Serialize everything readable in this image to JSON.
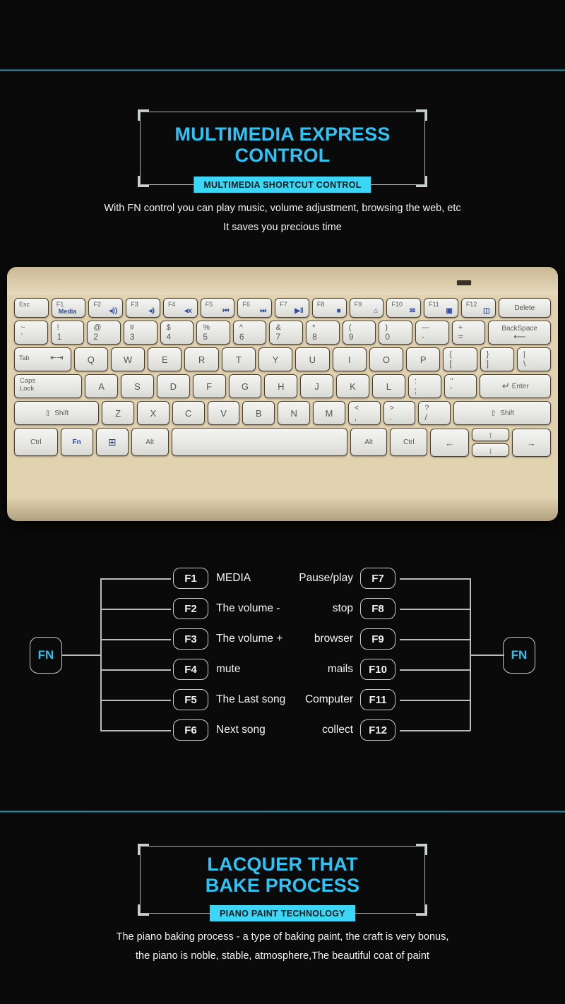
{
  "sections": {
    "multimedia": {
      "title": "MULTIMEDIA EXPRESS CONTROL",
      "badge": "MULTIMEDIA SHORTCUT CONTROL",
      "desc_line1": "With FN control you can play music, volume adjustment, browsing the web, etc",
      "desc_line2": "It saves you precious time"
    },
    "lacquer": {
      "title": "LACQUER THAT\nBAKE PROCESS",
      "badge": "PIANO PAINT TECHNOLOGY",
      "desc_line1": "The piano baking process - a type of baking paint, the craft is very bonus,",
      "desc_line2": "the piano is noble, stable, atmosphere,The beautiful coat of paint"
    }
  },
  "colors": {
    "accent_cyan": "#2ec2f5",
    "badge_bg": "#3ad7f7",
    "divider": "#3c93ab",
    "keyboard_gold": "#e1d2b0",
    "key_face": "#eeeeec",
    "fn_blue": "#2e4d9e"
  },
  "keyboard": {
    "row_fn": [
      {
        "label": "Esc"
      },
      {
        "label": "F1",
        "sub": "Media"
      },
      {
        "label": "F2",
        "icon": "volume-low-icon",
        "glyph": "◂))"
      },
      {
        "label": "F3",
        "icon": "volume-high-icon",
        "glyph": "◂)"
      },
      {
        "label": "F4",
        "icon": "mute-icon",
        "glyph": "◂x"
      },
      {
        "label": "F5",
        "icon": "previous-track-icon",
        "glyph": "⏮"
      },
      {
        "label": "F6",
        "icon": "next-track-icon",
        "glyph": "⏭"
      },
      {
        "label": "F7",
        "icon": "play-pause-icon",
        "glyph": "▶‖"
      },
      {
        "label": "F8",
        "icon": "stop-icon",
        "glyph": "■"
      },
      {
        "label": "F9",
        "icon": "browser-home-icon",
        "glyph": "⌂"
      },
      {
        "label": "F10",
        "icon": "mail-icon",
        "glyph": "✉"
      },
      {
        "label": "F11",
        "icon": "computer-icon",
        "glyph": "▣"
      },
      {
        "label": "F12",
        "icon": "collect-icon",
        "glyph": "◫"
      },
      {
        "label": "Delete"
      }
    ],
    "row_num": [
      {
        "top": "~",
        "bot": "`"
      },
      {
        "top": "!",
        "bot": "1"
      },
      {
        "top": "@",
        "bot": "2"
      },
      {
        "top": "#",
        "bot": "3"
      },
      {
        "top": "$",
        "bot": "4"
      },
      {
        "top": "%",
        "bot": "5"
      },
      {
        "top": "^",
        "bot": "6"
      },
      {
        "top": "&",
        "bot": "7"
      },
      {
        "top": "*",
        "bot": "8"
      },
      {
        "top": "(",
        "bot": "9"
      },
      {
        "top": ")",
        "bot": "0"
      },
      {
        "top": "—",
        "bot": "-"
      },
      {
        "top": "+",
        "bot": "="
      },
      {
        "label": "BackSpace",
        "glyph": "⟵"
      }
    ],
    "row_qwerty": [
      {
        "label": "Tab",
        "glyph": "⇤⇥"
      },
      {
        "label": "Q"
      },
      {
        "label": "W"
      },
      {
        "label": "E"
      },
      {
        "label": "R"
      },
      {
        "label": "T"
      },
      {
        "label": "Y"
      },
      {
        "label": "U"
      },
      {
        "label": "I"
      },
      {
        "label": "O"
      },
      {
        "label": "P"
      },
      {
        "top": "{",
        "bot": "["
      },
      {
        "top": "}",
        "bot": "]"
      },
      {
        "top": "|",
        "bot": "\\"
      }
    ],
    "row_home": [
      {
        "label": "Caps\nLock"
      },
      {
        "label": "A"
      },
      {
        "label": "S"
      },
      {
        "label": "D"
      },
      {
        "label": "F"
      },
      {
        "label": "G"
      },
      {
        "label": "H"
      },
      {
        "label": "J"
      },
      {
        "label": "K"
      },
      {
        "label": "L"
      },
      {
        "top": ":",
        "bot": ";"
      },
      {
        "top": "\"",
        "bot": "'"
      },
      {
        "label": "Enter",
        "glyph": "↵"
      }
    ],
    "row_shift": [
      {
        "label": "Shift",
        "glyph": "⇧"
      },
      {
        "label": "Z"
      },
      {
        "label": "X"
      },
      {
        "label": "C"
      },
      {
        "label": "V"
      },
      {
        "label": "B"
      },
      {
        "label": "N"
      },
      {
        "label": "M"
      },
      {
        "top": "<",
        "bot": ","
      },
      {
        "top": ">",
        "bot": "."
      },
      {
        "top": "?",
        "bot": "/"
      },
      {
        "label": "Shift",
        "glyph": "⇧"
      }
    ],
    "row_bottom": [
      {
        "label": "Ctrl"
      },
      {
        "label": "Fn",
        "blue": true
      },
      {
        "label": "",
        "icon": "windows-icon",
        "glyph": "⊞"
      },
      {
        "label": "Alt"
      },
      {
        "label": " "
      },
      {
        "label": "Alt"
      },
      {
        "label": "Ctrl"
      },
      {
        "label": "",
        "icon": "arrow-left-icon",
        "glyph": "←"
      },
      {
        "label": "",
        "icon": "arrow-up-icon",
        "glyph": "↑"
      },
      {
        "label": "",
        "icon": "arrow-down-icon",
        "glyph": "↓"
      },
      {
        "label": "",
        "icon": "arrow-right-icon",
        "glyph": "→"
      }
    ]
  },
  "fn_diagram": {
    "hub_left": "FN",
    "hub_right": "FN",
    "left_items": [
      {
        "key": "F1",
        "label": "MEDIA"
      },
      {
        "key": "F2",
        "label": "The volume -"
      },
      {
        "key": "F3",
        "label": "The volume +"
      },
      {
        "key": "F4",
        "label": "mute"
      },
      {
        "key": "F5",
        "label": "The Last song"
      },
      {
        "key": "F6",
        "label": "Next song"
      }
    ],
    "right_items": [
      {
        "key": "F7",
        "label": "Pause/play"
      },
      {
        "key": "F8",
        "label": "stop"
      },
      {
        "key": "F9",
        "label": "browser"
      },
      {
        "key": "F10",
        "label": "mails"
      },
      {
        "key": "F11",
        "label": "Computer"
      },
      {
        "key": "F12",
        "label": "collect"
      }
    ]
  }
}
